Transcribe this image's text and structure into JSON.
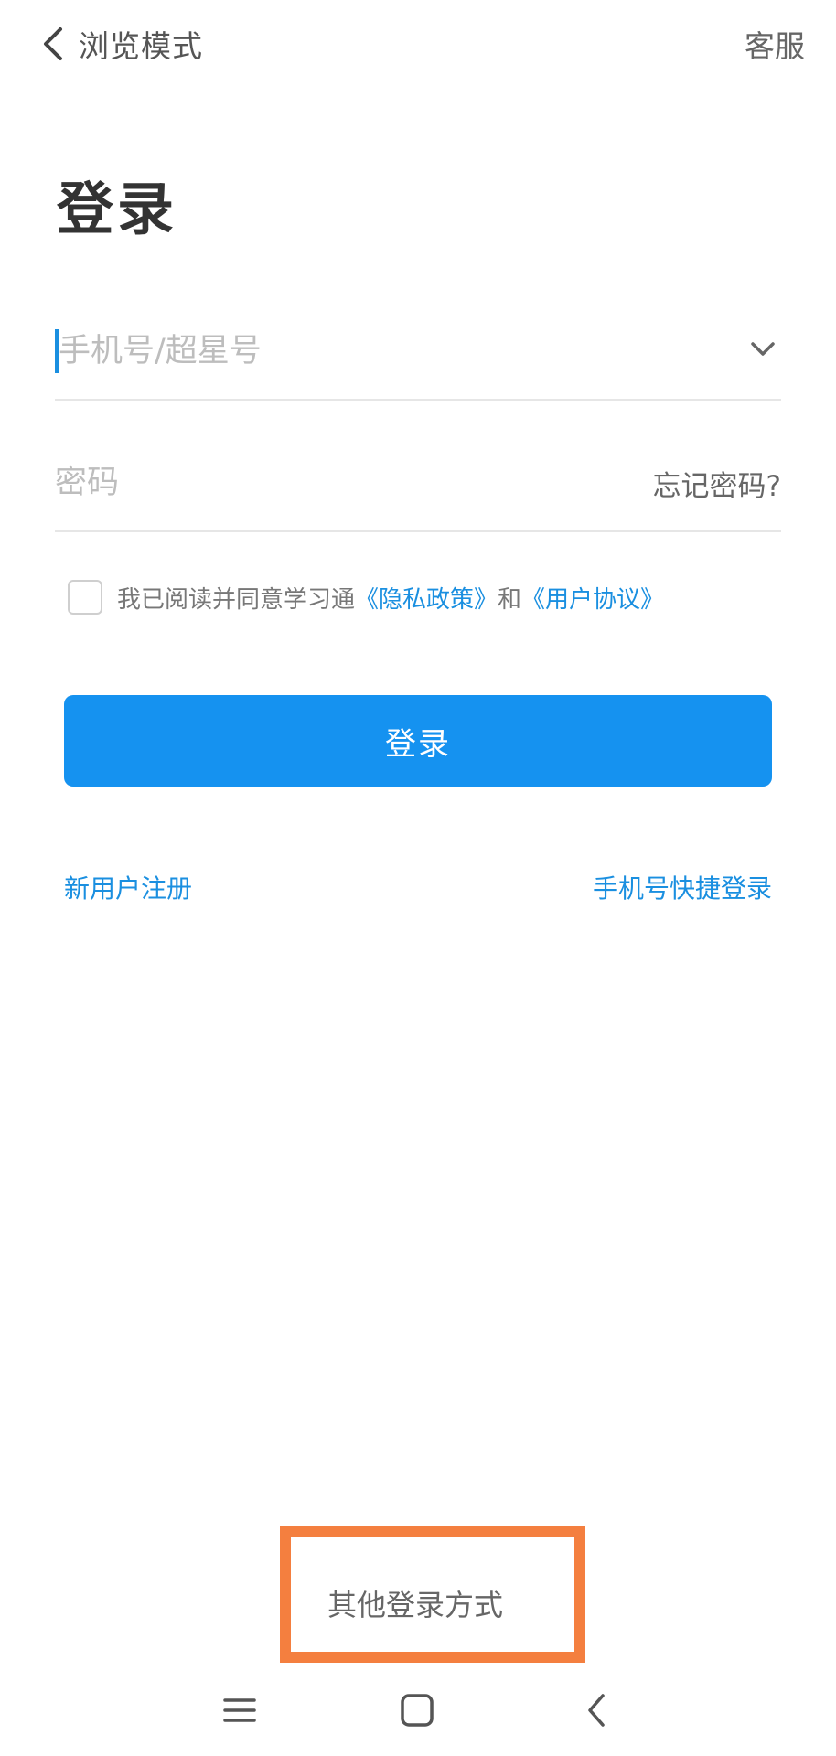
{
  "topbar": {
    "back_label": "浏览模式",
    "service_label": "客服"
  },
  "page": {
    "title": "登录"
  },
  "form": {
    "phone_placeholder": "手机号/超星号",
    "phone_value": "",
    "password_placeholder": "密码",
    "password_value": "",
    "forgot_label": "忘记密码?"
  },
  "agreement": {
    "checked": false,
    "prefix": "我已阅读并同意学习通",
    "privacy_link": "《隐私政策》",
    "and_text": "和",
    "terms_link": "《用户协议》"
  },
  "actions": {
    "login_label": "登录",
    "register_label": "新用户注册",
    "quick_login_label": "手机号快捷登录",
    "other_login_label": "其他登录方式"
  },
  "navbar": {
    "icons": [
      "menu-icon",
      "home-icon",
      "back-icon"
    ]
  },
  "colors": {
    "accent": "#1592f0",
    "link": "#1a8fe0",
    "highlight_box": "#f47f3f"
  }
}
